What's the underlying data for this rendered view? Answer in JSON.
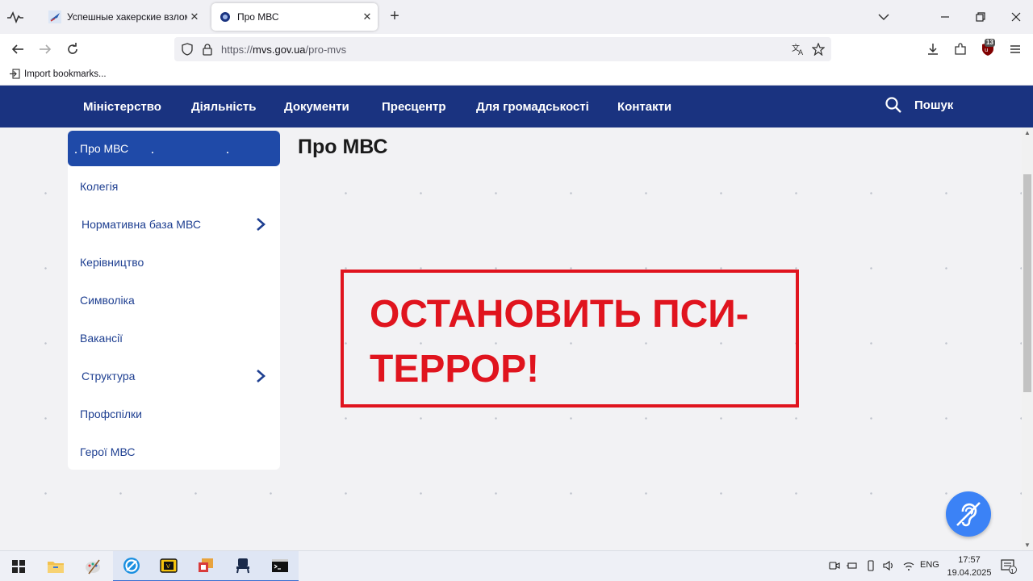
{
  "browser": {
    "tabs": [
      {
        "title": "Успешные хакерские взломы.",
        "active": false
      },
      {
        "title": "Про МВС",
        "active": true
      }
    ],
    "url_prefix": "https://",
    "url_host": "mvs.gov.ua",
    "url_path": "/pro-mvs",
    "extension_badge": "13",
    "bookmark": "Import bookmarks..."
  },
  "site": {
    "menu": [
      "Міністерство",
      "Діяльність",
      "Документи",
      "Пресцентр",
      "Для громадськості",
      "Контакти"
    ],
    "search_label": "Пошук",
    "sidebar": [
      {
        "label": "Про МВС",
        "active": true,
        "has_children": false
      },
      {
        "label": "Колегія",
        "active": false,
        "has_children": false
      },
      {
        "label": "Нормативна база МВС",
        "active": false,
        "has_children": true
      },
      {
        "label": "Керівництво",
        "active": false,
        "has_children": false
      },
      {
        "label": "Символіка",
        "active": false,
        "has_children": false
      },
      {
        "label": "Вакансії",
        "active": false,
        "has_children": false
      },
      {
        "label": "Структура",
        "active": false,
        "has_children": true
      },
      {
        "label": "Профспілки",
        "active": false,
        "has_children": false
      },
      {
        "label": "Герої МВС",
        "active": false,
        "has_children": false
      }
    ],
    "page_title": "Про МВС",
    "banner_text": "ОСТАНОВИТЬ ПСИ-ТЕРРОР!"
  },
  "taskbar": {
    "language": "ENG",
    "time": "17:57",
    "date": "19.04.2025",
    "notification_count": "1"
  },
  "colors": {
    "header_bg": "#1a3380",
    "sidebar_active": "#1f4aa8",
    "sidebar_text": "#1e3f91",
    "banner_red": "#e0141e",
    "a11y_button": "#3b82f6"
  }
}
